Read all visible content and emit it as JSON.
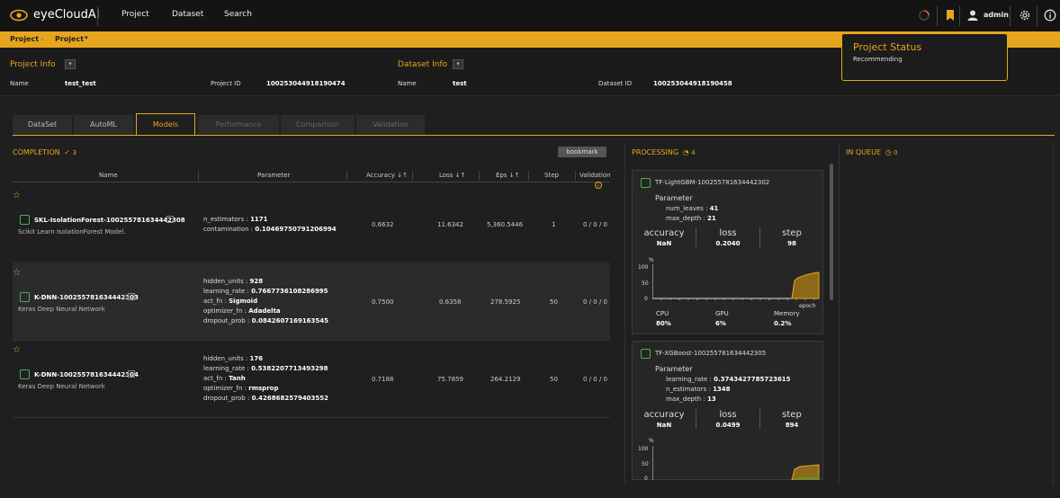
{
  "header": {
    "app_name": "eyeCloudAI",
    "nav": [
      "Project",
      "Dataset",
      "Search"
    ],
    "user": "admin"
  },
  "breadcrumb": {
    "items": [
      "Project",
      "Project"
    ]
  },
  "project_info": {
    "title": "Project Info",
    "name_label": "Name",
    "name_value": "test_test",
    "id_label": "Project ID",
    "id_value": "100253044918190474"
  },
  "dataset_info": {
    "title": "Dataset Info",
    "name_label": "Name",
    "name_value": "test",
    "id_label": "Dataset ID",
    "id_value": "100253044918190458"
  },
  "status_popup": {
    "title": "Project Status",
    "value": "Recommending"
  },
  "tabs": [
    "DataSet",
    "AutoML",
    "Models",
    "Performance",
    "Comparison",
    "Validation"
  ],
  "completion": {
    "title": "COMPLETION",
    "count": "3",
    "bookmark_label": "bookmark",
    "columns": [
      "Name",
      "Parameter",
      "Accuracy",
      "Loss",
      "Eps",
      "Step",
      "Validation"
    ],
    "sort_icon": "↓↑",
    "rows": [
      {
        "name": "SKL-IsolationForest-100255781634442308",
        "desc": "Scikit Learn IsolationForest Model.",
        "params": [
          [
            "n_estimators",
            "1171"
          ],
          [
            "contamination",
            "0.10469750791206994"
          ]
        ],
        "accuracy": "0.6632",
        "loss": "11.6342",
        "eps": "5,360.5446",
        "step": "1",
        "validation": "0 / 0 / 0"
      },
      {
        "name": "K-DNN-100255781634442303",
        "desc": "Keras Deep Neural Network",
        "params": [
          [
            "hidden_units",
            "928"
          ],
          [
            "learning_rate",
            "0.7667736108286995"
          ],
          [
            "act_fn",
            "Sigmoid"
          ],
          [
            "optimizer_fn",
            "Adadelta"
          ],
          [
            "dropout_prob",
            "0.0842607169163545"
          ]
        ],
        "accuracy": "0.7500",
        "loss": "0.6358",
        "eps": "278.5925",
        "step": "50",
        "validation": "0 / 0 / 0"
      },
      {
        "name": "K-DNN-100255781634442304",
        "desc": "Keras Deep Neural Network",
        "params": [
          [
            "hidden_units",
            "176"
          ],
          [
            "learning_rate",
            "0.5382207713493298"
          ],
          [
            "act_fn",
            "Tanh"
          ],
          [
            "optimizer_fn",
            "rmsprop"
          ],
          [
            "dropout_prob",
            "0.4268682579403552"
          ]
        ],
        "accuracy": "0.7188",
        "loss": "75.7859",
        "eps": "264.2129",
        "step": "50",
        "validation": "0 / 0 / 0"
      }
    ]
  },
  "processing": {
    "title": "PROCESSING",
    "count": "4",
    "cards": [
      {
        "name": "TF-LightGBM-100255781634442302",
        "param_title": "Parameter",
        "params": [
          [
            "num_leaves",
            "41"
          ],
          [
            "max_depth",
            "21"
          ]
        ],
        "metrics": [
          [
            "accuracy",
            "NaN"
          ],
          [
            "loss",
            "0.2040"
          ],
          [
            "step",
            "98"
          ]
        ],
        "chart_unit": "%",
        "chart_ticks": [
          "100",
          "50",
          "0"
        ],
        "chart_xlabel": "epoch",
        "usage": [
          [
            "CPU",
            "80%"
          ],
          [
            "GPU",
            "6%"
          ],
          [
            "Memory",
            "0.2%"
          ]
        ]
      },
      {
        "name": "TF-XGBoost-100255781634442305",
        "param_title": "Parameter",
        "params": [
          [
            "learning_rate",
            "0.3743427785723615"
          ],
          [
            "n_estimators",
            "1348"
          ],
          [
            "max_depth",
            "13"
          ]
        ],
        "metrics": [
          [
            "accuracy",
            "NaN"
          ],
          [
            "loss",
            "0.0499"
          ],
          [
            "step",
            "894"
          ]
        ],
        "chart_unit": "%",
        "chart_ticks": [
          "100",
          "50",
          "0"
        ]
      }
    ]
  },
  "queue": {
    "title": "IN QUEUE",
    "count": "0"
  },
  "colors": {
    "accent": "#e7a51d",
    "chip": "#4caf50"
  }
}
